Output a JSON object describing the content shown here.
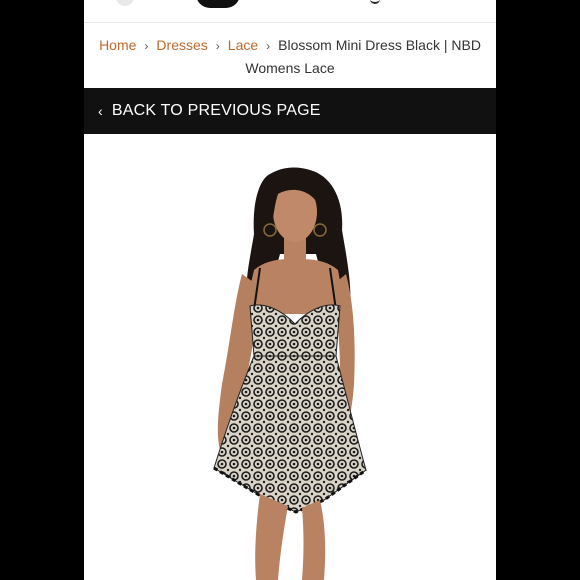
{
  "breadcrumb": {
    "items": [
      "Home",
      "Dresses",
      "Lace"
    ],
    "current": "Blossom Mini Dress Black | NBD Womens Lace",
    "separator": "›"
  },
  "back_button": {
    "icon": "chevron-left-icon",
    "glyph": "‹",
    "label": "BACK TO PREVIOUS PAGE"
  },
  "product": {
    "image_alt": "Model wearing lace mini dress"
  },
  "colors": {
    "link": "#c0692b",
    "bar": "#111111",
    "frame": "#000000"
  }
}
